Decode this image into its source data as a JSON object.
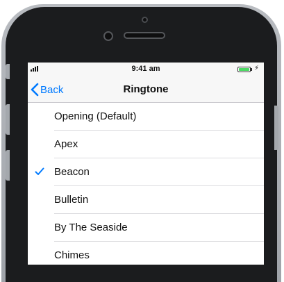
{
  "status_bar": {
    "time": "9:41 am"
  },
  "nav": {
    "back_label": "Back",
    "title": "Ringtone"
  },
  "ringtones": [
    {
      "label": "Opening (Default)",
      "selected": false
    },
    {
      "label": "Apex",
      "selected": false
    },
    {
      "label": "Beacon",
      "selected": true
    },
    {
      "label": "Bulletin",
      "selected": false
    },
    {
      "label": "By The Seaside",
      "selected": false
    },
    {
      "label": "Chimes",
      "selected": false
    }
  ],
  "colors": {
    "accent": "#007aff",
    "battery": "#4cd964"
  }
}
